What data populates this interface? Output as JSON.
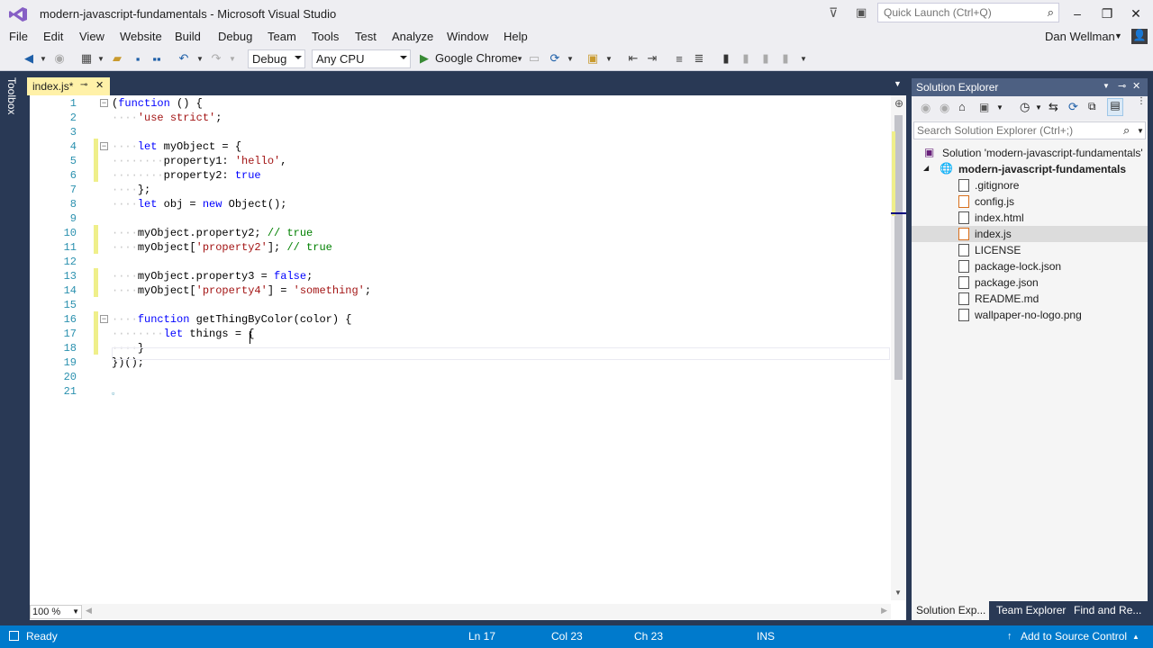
{
  "window": {
    "title": "modern-javascript-fundamentals - Microsoft Visual Studio",
    "quick_launch_placeholder": "Quick Launch (Ctrl+Q)"
  },
  "menu": [
    "File",
    "Edit",
    "View",
    "Website",
    "Build",
    "Debug",
    "Team",
    "Tools",
    "Test",
    "Analyze",
    "Window",
    "Help"
  ],
  "user": {
    "name": "Dan Wellman"
  },
  "toolbar": {
    "configuration": "Debug",
    "platform": "Any CPU",
    "run_target": "Google Chrome"
  },
  "toolbox": {
    "label": "Toolbox"
  },
  "document_tab": {
    "label": "index.js*"
  },
  "editor": {
    "zoom": "100 %",
    "lines": [
      {
        "n": "1",
        "text": "(function () {"
      },
      {
        "n": "2",
        "text": "    'use strict';"
      },
      {
        "n": "3",
        "text": ""
      },
      {
        "n": "4",
        "text": "    let myObject = {"
      },
      {
        "n": "5",
        "text": "        property1: 'hello',"
      },
      {
        "n": "6",
        "text": "        property2: true"
      },
      {
        "n": "7",
        "text": "    };"
      },
      {
        "n": "8",
        "text": "    let obj = new Object();"
      },
      {
        "n": "9",
        "text": ""
      },
      {
        "n": "10",
        "text": "    myObject.property2; // true"
      },
      {
        "n": "11",
        "text": "    myObject['property2']; // true"
      },
      {
        "n": "12",
        "text": ""
      },
      {
        "n": "13",
        "text": "    myObject.property3 = false;"
      },
      {
        "n": "14",
        "text": "    myObject['property4'] = 'something';"
      },
      {
        "n": "15",
        "text": ""
      },
      {
        "n": "16",
        "text": "    function getThingByColor(color) {"
      },
      {
        "n": "17",
        "text": "        let things = {"
      },
      {
        "n": "18",
        "text": "    }"
      },
      {
        "n": "19",
        "text": "})();"
      },
      {
        "n": "20",
        "text": ""
      },
      {
        "n": "21",
        "text": ""
      }
    ]
  },
  "solution_explorer": {
    "title": "Solution Explorer",
    "search_placeholder": "Search Solution Explorer (Ctrl+;)",
    "solution": "Solution 'modern-javascript-fundamentals'",
    "project": "modern-javascript-fundamentals",
    "files": [
      ".gitignore",
      "config.js",
      "index.html",
      "index.js",
      "LICENSE",
      "package-lock.json",
      "package.json",
      "README.md",
      "wallpaper-no-logo.png"
    ],
    "selected_file": "index.js",
    "tabs": [
      "Solution Exp...",
      "Team Explorer",
      "Find and Re..."
    ]
  },
  "status": {
    "state": "Ready",
    "line": "Ln 17",
    "col": "Col 23",
    "ch": "Ch 23",
    "mode": "INS",
    "source_control": "Add to Source Control"
  },
  "colors": {
    "accent": "#007acc",
    "chrome": "#eeeef2",
    "frame": "#293955",
    "tab_active": "#fff1a8"
  }
}
